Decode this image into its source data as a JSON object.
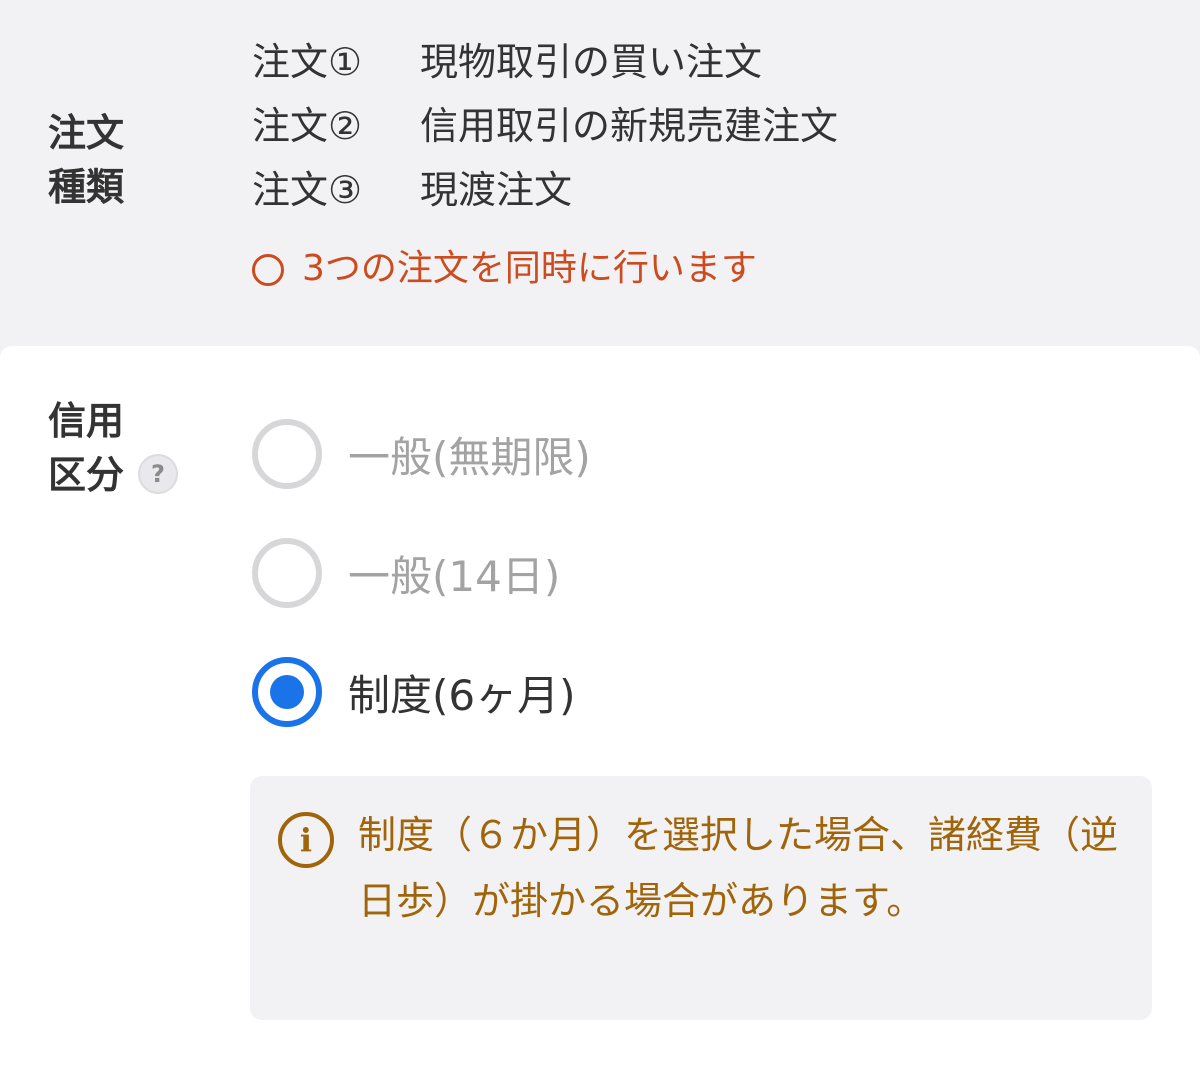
{
  "order_type": {
    "label_line1": "注文",
    "label_line2": "種類",
    "orders": [
      {
        "no": "注文①",
        "desc": "現物取引の買い注文"
      },
      {
        "no": "注文②",
        "desc": "信用取引の新規売建注文"
      },
      {
        "no": "注文③",
        "desc": "現渡注文"
      }
    ],
    "notice": "3つの注文を同時に行います"
  },
  "credit_type": {
    "label_line1": "信用",
    "label_line2": "区分",
    "help": "?",
    "options": [
      {
        "label": "一般(無期限)",
        "selected": false,
        "disabled": true
      },
      {
        "label": "一般(14日)",
        "selected": false,
        "disabled": true
      },
      {
        "label": "制度(6ヶ月)",
        "selected": true,
        "disabled": false
      }
    ],
    "info_icon": "i",
    "info_text": "制度（６か月）を選択した場合、諸経費（逆日歩）が掛かる場合があります。"
  },
  "colors": {
    "accent_blue": "#1a73e8",
    "notice_red": "#cc4b1f",
    "info_brown": "#a0650a",
    "background_gray": "#f2f2f5"
  }
}
